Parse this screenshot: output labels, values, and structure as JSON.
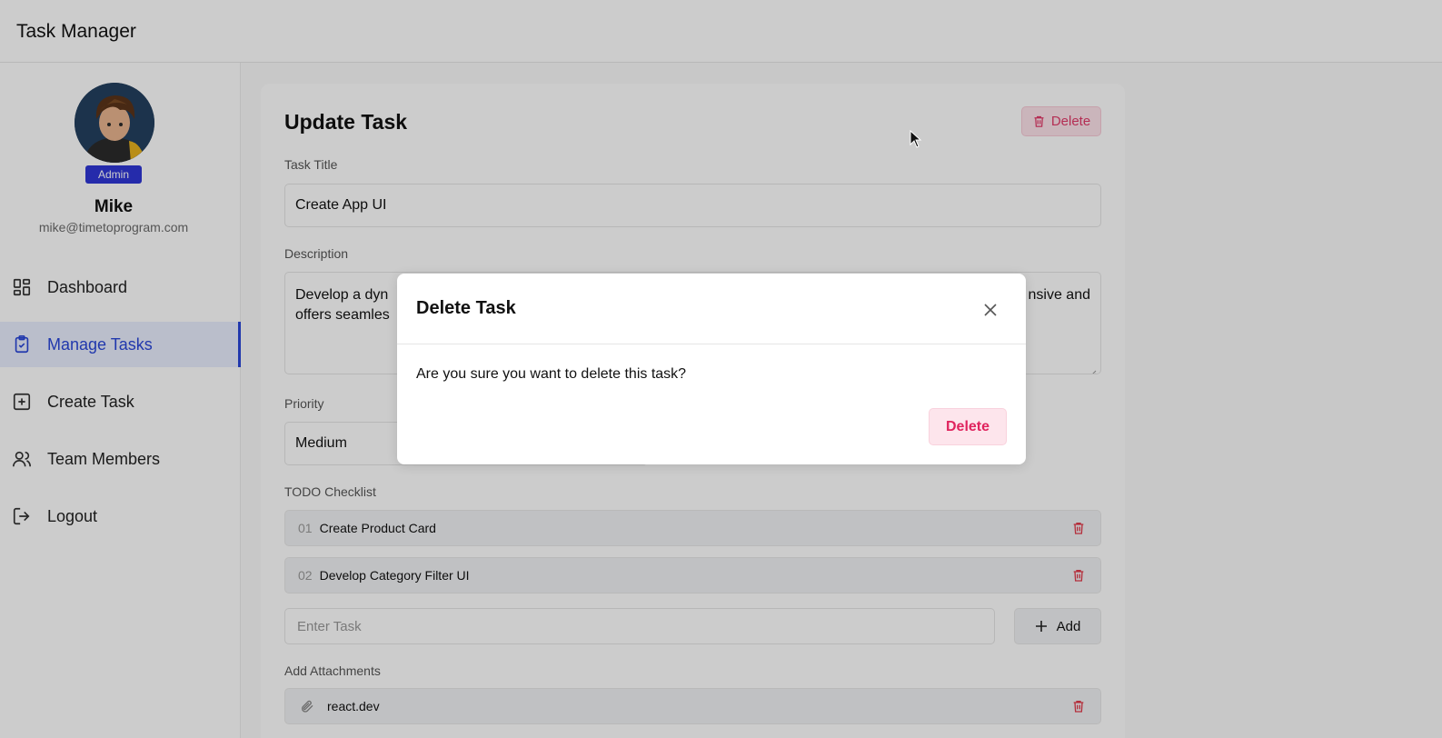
{
  "app": {
    "title": "Task Manager"
  },
  "user": {
    "role": "Admin",
    "name": "Mike",
    "email": "mike@timetoprogram.com"
  },
  "nav": {
    "items": [
      {
        "label": "Dashboard",
        "icon": "dashboard-icon",
        "active": false
      },
      {
        "label": "Manage Tasks",
        "icon": "clipboard-check-icon",
        "active": true
      },
      {
        "label": "Create Task",
        "icon": "plus-square-icon",
        "active": false
      },
      {
        "label": "Team Members",
        "icon": "users-icon",
        "active": false
      },
      {
        "label": "Logout",
        "icon": "logout-icon",
        "active": false
      }
    ]
  },
  "form": {
    "title": "Update Task",
    "delete_label": "Delete",
    "task_title_label": "Task Title",
    "task_title_value": "Create App UI",
    "description_label": "Description",
    "description_line1_start": "Develop a dyn",
    "description_line1_end": "nsive and",
    "description_line2": "offers seamles",
    "priority_label": "Priority",
    "priority_value": "Medium",
    "todo_label": "TODO Checklist",
    "todos": [
      {
        "num": "01",
        "text": "Create Product Card"
      },
      {
        "num": "02",
        "text": "Develop Category Filter UI"
      }
    ],
    "todo_placeholder": "Enter Task",
    "add_label": "Add",
    "attachments_label": "Add Attachments",
    "attachments": [
      {
        "text": "react.dev"
      }
    ]
  },
  "modal": {
    "title": "Delete Task",
    "message": "Are you sure you want to delete this task?",
    "delete_label": "Delete"
  },
  "colors": {
    "accent": "#2a47d9",
    "badge": "#2f36d6",
    "danger": "#e0245e",
    "danger_bg": "#fde5ec"
  }
}
